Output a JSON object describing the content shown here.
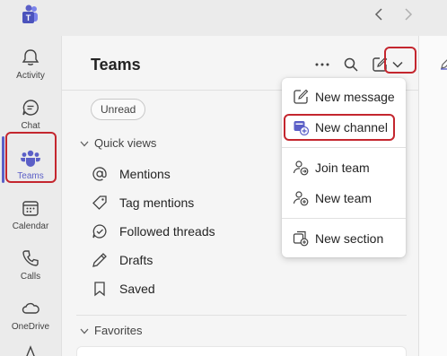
{
  "app": {
    "name": "Microsoft Teams"
  },
  "titlebar": {
    "back_label": "Back",
    "forward_label": "Forward"
  },
  "rail": {
    "items": [
      {
        "label": "Activity",
        "icon": "bell-icon"
      },
      {
        "label": "Chat",
        "icon": "chat-icon"
      },
      {
        "label": "Teams",
        "icon": "teams-icon",
        "active": true
      },
      {
        "label": "Calendar",
        "icon": "calendar-icon"
      },
      {
        "label": "Calls",
        "icon": "phone-icon"
      },
      {
        "label": "OneDrive",
        "icon": "cloud-icon"
      }
    ]
  },
  "panel": {
    "title": "Teams",
    "filter_chip": "Unread",
    "quick_views": {
      "header": "Quick views",
      "items": [
        {
          "label": "Mentions",
          "icon": "at-icon"
        },
        {
          "label": "Tag mentions",
          "icon": "tag-icon"
        },
        {
          "label": "Followed threads",
          "icon": "followed-threads-icon"
        },
        {
          "label": "Drafts",
          "icon": "pencil-icon"
        },
        {
          "label": "Saved",
          "icon": "bookmark-icon"
        }
      ]
    },
    "favorites": {
      "header": "Favorites"
    }
  },
  "menu": {
    "items": [
      {
        "label": "New message",
        "icon": "compose-icon"
      },
      {
        "label": "New channel",
        "icon": "new-channel-icon",
        "highlighted": true
      },
      {
        "label": "Join team",
        "icon": "join-team-icon"
      },
      {
        "label": "New team",
        "icon": "new-team-icon"
      },
      {
        "label": "New section",
        "icon": "new-section-icon"
      }
    ]
  },
  "colors": {
    "accent": "#5b5fc7",
    "highlight_border": "#c4262e"
  }
}
